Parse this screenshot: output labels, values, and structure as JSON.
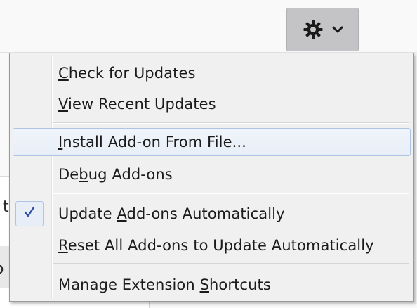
{
  "toolbar": {
    "gear_icon": "gear-icon",
    "chevron_icon": "chevron-down-icon",
    "button_color": "#c4c4c6"
  },
  "background": {
    "fragment_1": "t",
    "fragment_2": "o"
  },
  "menu": {
    "check_updates": {
      "pre": "",
      "key": "C",
      "post": "heck for Updates"
    },
    "view_recent": {
      "pre": "",
      "key": "V",
      "post": "iew Recent Updates"
    },
    "install_from_file": {
      "pre": "",
      "key": "I",
      "post": "nstall Add-on From File..."
    },
    "debug_addons": {
      "pre": "De",
      "key": "b",
      "post": "ug Add-ons"
    },
    "update_auto": {
      "pre": "Update ",
      "key": "A",
      "post": "dd-ons Automatically",
      "checked": true,
      "check_icon": "checkmark-icon"
    },
    "reset_auto": {
      "pre": "",
      "key": "R",
      "post": "eset All Add-ons to Update Automatically"
    },
    "manage_shortcuts": {
      "pre": "Manage Extension ",
      "key": "S",
      "post": "hortcuts"
    },
    "highlight_color": "#e8eef8",
    "check_color": "#2a4ea0"
  }
}
